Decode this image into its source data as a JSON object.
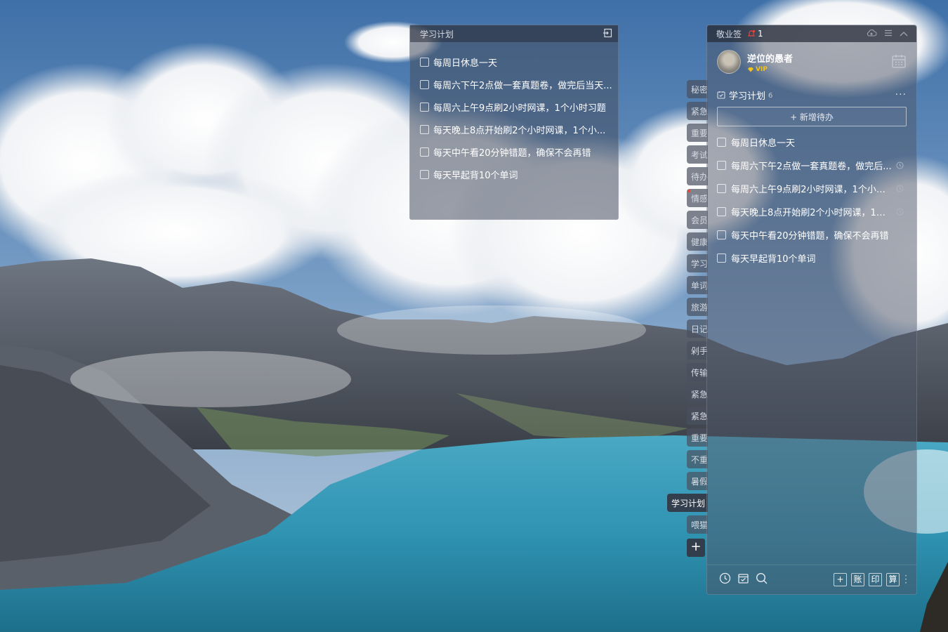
{
  "float_note": {
    "title": "学习计划",
    "items": [
      "每周日休息一天",
      "每周六下午2点做一套真题卷，做完后当天...",
      "每周六上午9点刷2小时网课，1个小时习题",
      "每天晚上8点开始刷2个小时网课，1个小...",
      "每天中午看20分钟错题，确保不会再错",
      "每天早起背10个单词"
    ]
  },
  "tabs": [
    "秘密",
    "紧急",
    "重要",
    "考试",
    "待办",
    "情感",
    "会员",
    "健康",
    "学习",
    "单词",
    "旅游",
    "日记",
    "剁手",
    "传输",
    "紧急",
    "紧急",
    "重要",
    "不重",
    "暑假",
    "学习计划",
    "喂猫"
  ],
  "tabs_active": "学习计划",
  "add_tab_label": "+",
  "panel": {
    "app_name": "敬业签",
    "notif_count": "1",
    "user_name": "逆位的愚者",
    "vip_label": "VIP",
    "list_title": "学习计划",
    "list_count": "6",
    "more_label": "···",
    "add_todo_label": "+ 新增待办",
    "items": [
      {
        "text": "每周日休息一天",
        "reminder": false
      },
      {
        "text": "每周六下午2点做一套真题卷，做完后...",
        "reminder": true
      },
      {
        "text": "每周六上午9点刷2小时网课，1个小时...",
        "reminder": true
      },
      {
        "text": "每天晚上8点开始刷2个小时网课，1个...",
        "reminder": true
      },
      {
        "text": "每天中午看20分钟错题，确保不会再错",
        "reminder": false
      },
      {
        "text": "每天早起背10个单词",
        "reminder": false
      }
    ],
    "footer_buttons": [
      "+",
      "账",
      "印",
      "算"
    ]
  },
  "colors": {
    "sky": "#4f7fb4",
    "lake": "#3aa3bf",
    "vip": "#f3c21a",
    "notif_red": "#e8443a"
  }
}
